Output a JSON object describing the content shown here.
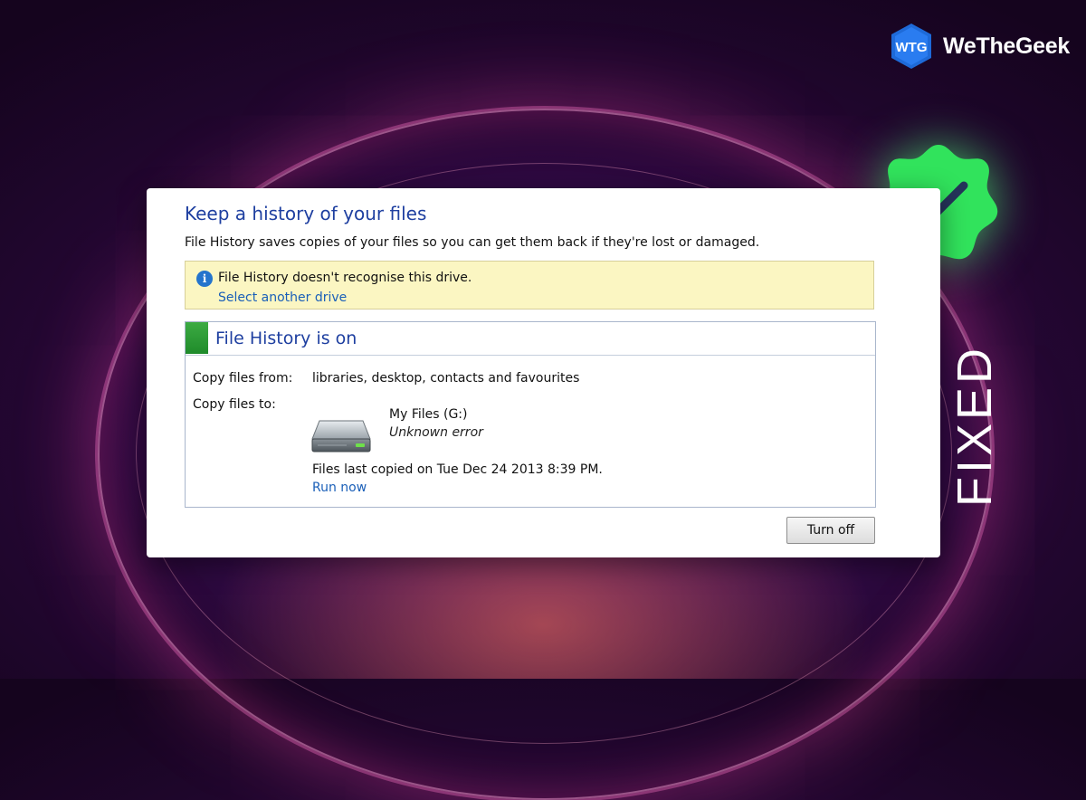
{
  "brand": {
    "name": "WeTheGeek",
    "logo_text": "WTG",
    "logo_color": "#1e6ad8"
  },
  "overlay": {
    "fixed_text": "FIXED",
    "badge_icon": "checkmark-icon",
    "badge_color": "#2fe35a"
  },
  "dialog": {
    "title": "Keep a history of your files",
    "subtitle": "File History saves copies of your files so you can get them back if they're lost or damaged.",
    "warning": {
      "icon": "info-icon",
      "message": "File History doesn't recognise this drive.",
      "link": "Select another drive"
    },
    "status": {
      "title": "File History is on",
      "copy_from_label": "Copy files from:",
      "copy_from_value": "libraries, desktop, contacts and favourites",
      "copy_to_label": "Copy files to:",
      "drive_name": "My Files (G:)",
      "drive_status": "Unknown error",
      "last_copied": "Files last copied on Tue  Dec  24  2013 8:39 PM.",
      "run_now": "Run now"
    },
    "turn_off_label": "Turn off"
  }
}
